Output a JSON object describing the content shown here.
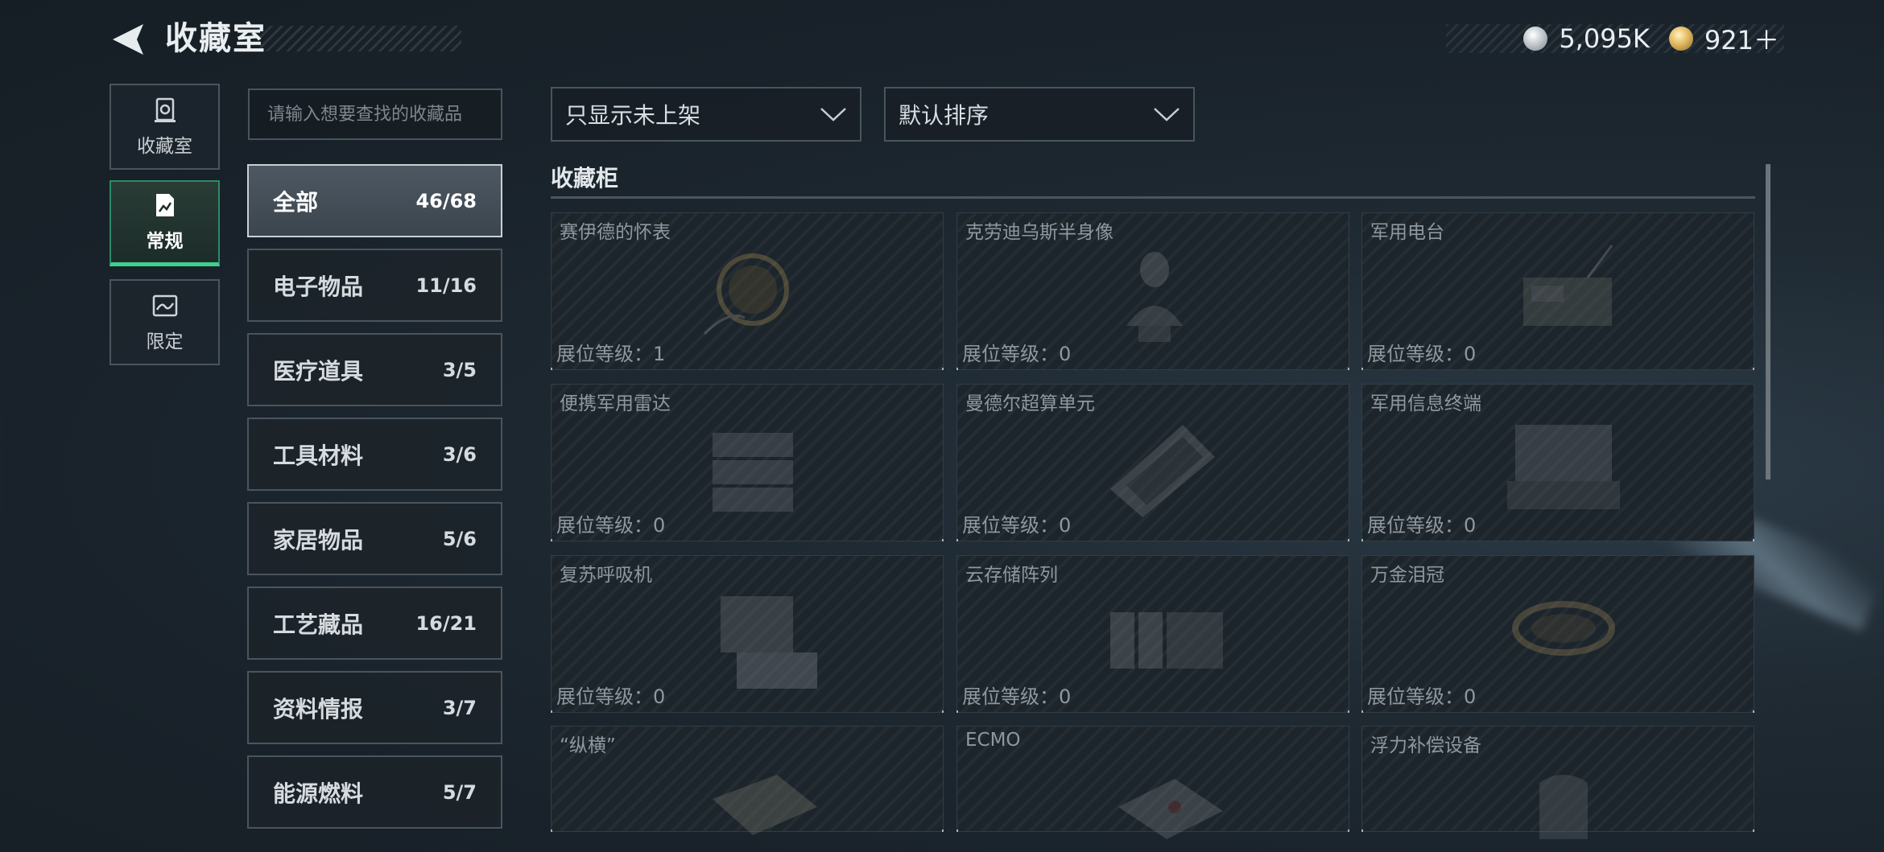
{
  "header": {
    "title": "收藏室",
    "currency": [
      {
        "icon": "silver-coin-icon",
        "value": "5,095K"
      },
      {
        "icon": "gold-coin-icon",
        "value": "921＋"
      }
    ]
  },
  "nav": [
    {
      "label": "收藏室",
      "icon": "collection-room-icon",
      "active": false
    },
    {
      "label": "常规",
      "icon": "regular-icon",
      "active": true
    },
    {
      "label": "限定",
      "icon": "limited-icon",
      "active": false
    }
  ],
  "search": {
    "placeholder": "请输入想要查找的收藏品"
  },
  "categories": [
    {
      "name": "全部",
      "count": "46/68",
      "active": true
    },
    {
      "name": "电子物品",
      "count": "11/16"
    },
    {
      "name": "医疗道具",
      "count": "3/5"
    },
    {
      "name": "工具材料",
      "count": "3/6"
    },
    {
      "name": "家居物品",
      "count": "5/6"
    },
    {
      "name": "工艺藏品",
      "count": "16/21"
    },
    {
      "name": "资料情报",
      "count": "3/7"
    },
    {
      "name": "能源燃料",
      "count": "5/7"
    }
  ],
  "filters": {
    "display": "只显示未上架",
    "sort": "默认排序"
  },
  "section": {
    "title": "收藏柜"
  },
  "items": [
    {
      "name": "赛伊德的怀表",
      "level": "展位等级：1"
    },
    {
      "name": "克劳迪乌斯半身像",
      "level": "展位等级：0"
    },
    {
      "name": "军用电台",
      "level": "展位等级：0"
    },
    {
      "name": "便携军用雷达",
      "level": "展位等级：0"
    },
    {
      "name": "曼德尔超算单元",
      "level": "展位等级：0"
    },
    {
      "name": "军用信息终端",
      "level": "展位等级：0"
    },
    {
      "name": "复苏呼吸机",
      "level": "展位等级：0"
    },
    {
      "name": "云存储阵列",
      "level": "展位等级：0"
    },
    {
      "name": "万金泪冠",
      "level": "展位等级：0"
    },
    {
      "name": "“纵横”",
      "level": ""
    },
    {
      "name": "ECMO",
      "level": ""
    },
    {
      "name": "浮力补偿设备",
      "level": ""
    }
  ]
}
